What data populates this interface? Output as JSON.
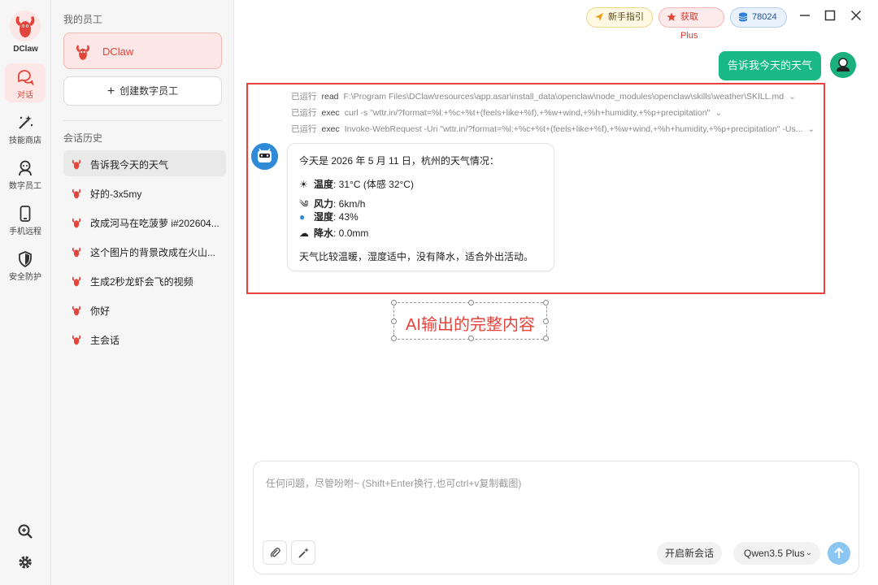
{
  "app": {
    "name": "DClaw"
  },
  "rail": {
    "items": [
      {
        "label": "对话"
      },
      {
        "label": "技能商店"
      },
      {
        "label": "数字员工"
      },
      {
        "label": "手机远程"
      },
      {
        "label": "安全防护"
      }
    ]
  },
  "sidebar": {
    "employees_title": "我的员工",
    "employee_name": "DClaw",
    "create_button": "创建数字员工",
    "history_title": "会话历史",
    "history": [
      "告诉我今天的天气",
      "好的-3x5my",
      "改成河马在吃菠萝 i#202604...",
      "这个图片的背景改成在火山...",
      "生成2秒龙虾会飞的视频",
      "你好",
      "主会话"
    ]
  },
  "topbar": {
    "guide": "新手指引",
    "get_plus": "获取Plus",
    "credits": "78024"
  },
  "chat": {
    "user_message": "告诉我今天的天气",
    "tool_calls": [
      {
        "status": "已运行",
        "tool": "read",
        "cmd": "F:\\Program Files\\DClaw\\resources\\app.asar\\install_data\\openclaw\\node_modules\\openclaw\\skills\\weather\\SKILL.md"
      },
      {
        "status": "已运行",
        "tool": "exec",
        "cmd": "curl -s \"wttr.in/?format=%l:+%c+%t+(feels+like+%f),+%w+wind,+%h+humidity,+%p+precipitation\""
      },
      {
        "status": "已运行",
        "tool": "exec",
        "cmd": "Invoke-WebRequest -Uri \"wttr.in/?format=%l:+%c+%t+(feels+like+%f),+%w+wind,+%h+humidity,+%p+precipitation\" -Us..."
      }
    ],
    "reply": {
      "intro": "今天是 2026 年 5 月 11 日，杭州的天气情况：",
      "temp_label": "温度",
      "temp_value": ": 31°C (体感 32°C)",
      "wind_label": "风力",
      "wind_value": ": 6km/h",
      "humidity_label": "湿度",
      "humidity_value": ": 43%",
      "rain_label": "降水",
      "rain_value": ": 0.0mm",
      "summary": "天气比较温暖，湿度适中，没有降水，适合外出活动。"
    }
  },
  "annotation": {
    "label": "AI输出的完整内容",
    "color": "#e8423a"
  },
  "input": {
    "placeholder": "任何问题，尽管吩咐~ (Shift+Enter换行,也可ctrl+v复制截图)",
    "new_chat": "开启新会话",
    "model": "Qwen3.5 Plus"
  },
  "colors": {
    "accent": "#e2453a",
    "user_bubble": "#19b985",
    "send": "#8cc6f2"
  }
}
